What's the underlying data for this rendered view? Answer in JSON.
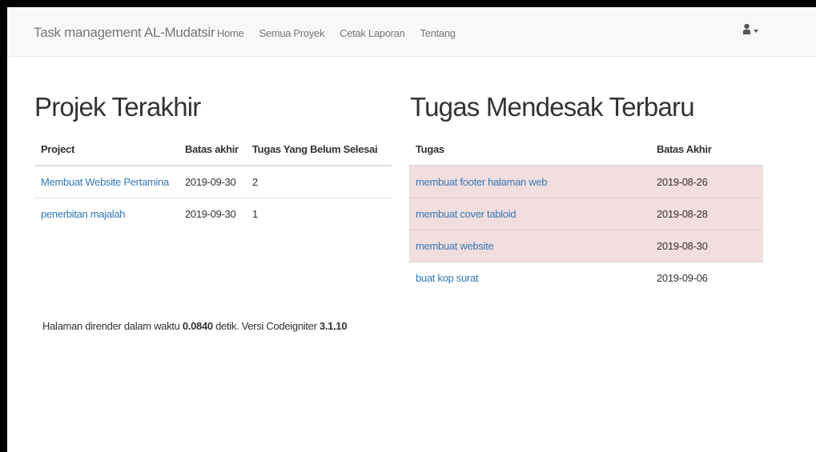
{
  "navbar": {
    "brand": "Task management AL-Mudatsir",
    "links": [
      "Home",
      "Semua Proyek",
      "Cetak Laporan",
      "Tentang"
    ]
  },
  "projects": {
    "title": "Projek Terakhir",
    "headers": [
      "Project",
      "Batas akhir",
      "Tugas Yang Belum Selesai"
    ],
    "rows": [
      {
        "name": "Membuat Website Pertamina",
        "deadline": "2019-09-30",
        "pending": "2"
      },
      {
        "name": "penerbitan majalah",
        "deadline": "2019-09-30",
        "pending": "1"
      }
    ]
  },
  "tasks": {
    "title": "Tugas Mendesak Terbaru",
    "headers": [
      "Tugas",
      "Batas Akhir"
    ],
    "rows": [
      {
        "name": "membuat footer halaman web",
        "deadline": "2019-08-26",
        "urgent": true
      },
      {
        "name": "membuat cover tabloid",
        "deadline": "2019-08-28",
        "urgent": true
      },
      {
        "name": "membuat website",
        "deadline": "2019-08-30",
        "urgent": true
      },
      {
        "name": "buat kop surat",
        "deadline": "2019-09-06",
        "urgent": false
      }
    ],
    "urgent_color": "#f2dede"
  },
  "footer": {
    "prefix": "Halaman dirender dalam waktu ",
    "time": "0.0840",
    "mid": " detik. Versi Codeigniter ",
    "version": "3.1.10"
  },
  "icons": {
    "user": "user-icon",
    "caret": "caret-down-icon"
  },
  "colors": {
    "link": "#337ab7",
    "navbar_bg": "#f8f8f8"
  }
}
